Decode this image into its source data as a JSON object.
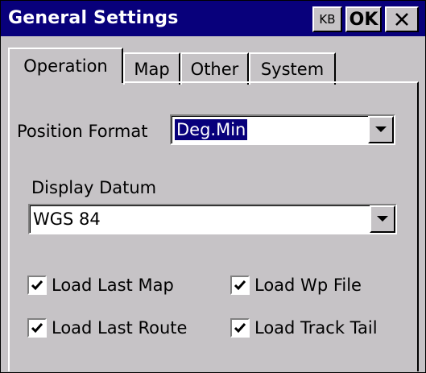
{
  "window": {
    "title": "General Settings",
    "buttons": {
      "kb": "KB",
      "ok": "OK",
      "close_icon": "close-icon"
    }
  },
  "tabs": [
    {
      "label": "Operation",
      "active": true
    },
    {
      "label": "Map",
      "active": false
    },
    {
      "label": "Other",
      "active": false
    },
    {
      "label": "System",
      "active": false
    }
  ],
  "operation": {
    "position_format": {
      "label": "Position Format",
      "value": "Deg.Min"
    },
    "display_datum": {
      "label": "Display Datum",
      "value": "WGS 84"
    },
    "checkboxes": [
      {
        "label": "Load Last Map",
        "checked": true
      },
      {
        "label": "Load Wp File",
        "checked": true
      },
      {
        "label": "Load Last Route",
        "checked": true
      },
      {
        "label": "Load Track Tail",
        "checked": true
      }
    ]
  },
  "icons": {
    "dropdown": "chevron-down-icon",
    "check": "check-icon"
  },
  "colors": {
    "title_bar": "#08007b",
    "face": "#c6c3c6",
    "selection": "#08007b"
  }
}
